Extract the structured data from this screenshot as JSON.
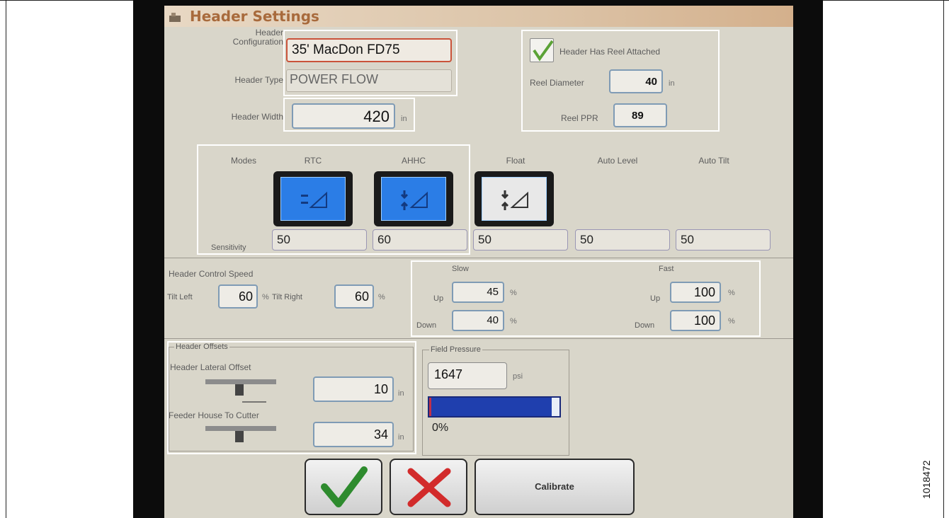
{
  "title": "Header Settings",
  "header": {
    "configuration_label": "Header\nConfiguration",
    "configuration_value": "35' MacDon FD75",
    "type_label": "Header Type",
    "type_value": "POWER FLOW",
    "width_label": "Header Width",
    "width_value": "420",
    "width_unit": "in"
  },
  "reel": {
    "has_reel_label": "Header Has Reel Attached",
    "has_reel_checked": true,
    "diameter_label": "Reel Diameter",
    "diameter_value": "40",
    "diameter_unit": "in",
    "ppr_label": "Reel PPR",
    "ppr_value": "89"
  },
  "modes": {
    "label": "Modes",
    "columns": [
      "RTC",
      "AHHC",
      "Float",
      "Auto Level",
      "Auto Tilt"
    ],
    "sensitivity_label": "Sensitivity",
    "sensitivity_values": [
      "50",
      "60",
      "50",
      "50",
      "50"
    ]
  },
  "speed": {
    "title": "Header Control Speed",
    "tilt_left_label": "Tilt Left",
    "tilt_left_value": "60",
    "tilt_right_label": "Tilt Right",
    "tilt_right_value": "60",
    "percent": "%",
    "slow_label": "Slow",
    "fast_label": "Fast",
    "up_label": "Up",
    "down_label": "Down",
    "slow_up": "45",
    "slow_down": "40",
    "fast_up": "100",
    "fast_down": "100"
  },
  "offsets": {
    "title": "Header Offsets",
    "lateral_label": "Header Lateral Offset",
    "lateral_value": "10",
    "feeder_label": "Feeder House To Cutter",
    "feeder_value": "34",
    "unit": "in"
  },
  "pressure": {
    "title": "Field Pressure",
    "value": "1647",
    "unit": "psi",
    "percent_text": "0%",
    "bar_fill_fraction": 0.94
  },
  "buttons": {
    "calibrate": "Calibrate"
  },
  "side_id": "1018472",
  "colors": {
    "screen_bg": "#d9d6ca",
    "title_color": "#a86a3c",
    "mode_active_blue": "#2b7de6",
    "pressure_bar_blue": "#1f3fae",
    "accept_green": "#2e8b2e",
    "cancel_red": "#d22b2b"
  }
}
